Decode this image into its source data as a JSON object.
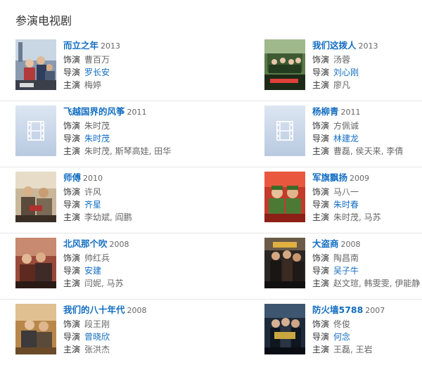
{
  "section_title": "参演电视剧",
  "labels": {
    "role": "饰演",
    "director": "导演",
    "cast": "主演"
  },
  "items": [
    {
      "title": "而立之年",
      "year": "2013",
      "role": "曹百万",
      "director": "罗长安",
      "cast": "梅婷",
      "poster": "photo"
    },
    {
      "title": "我们这拨人",
      "year": "2013",
      "role": "汤蓉",
      "director": "刘心刚",
      "cast": "廖凡",
      "poster": "photo"
    },
    {
      "title": "飞越国界的风筝",
      "year": "2011",
      "role": "朱时茂",
      "director": "朱时茂",
      "cast": "朱时茂, 斯琴高娃, 田华",
      "poster": "placeholder"
    },
    {
      "title": "杨柳青",
      "year": "2011",
      "role": "方佩诚",
      "director": "林建龙",
      "cast": "曹磊, 侯天来, 李倩",
      "poster": "placeholder"
    },
    {
      "title": "师傅",
      "year": "2010",
      "role": "许风",
      "director": "齐星",
      "cast": "李幼斌, 阎鹏",
      "poster": "photo"
    },
    {
      "title": "军旗飘扬",
      "year": "2009",
      "role": "马八一",
      "director": "朱时春",
      "cast": "朱时茂, 马苏",
      "poster": "photo"
    },
    {
      "title": "北风那个吹",
      "year": "2008",
      "role": "帅红兵",
      "director": "安建",
      "cast": "闫妮, 马苏",
      "poster": "photo"
    },
    {
      "title": "大盗商",
      "year": "2008",
      "role": "陶昌南",
      "director": "吴子牛",
      "cast": "赵文瑄, 韩雯雯, 伊能静",
      "poster": "photo"
    },
    {
      "title": "我们的八十年代",
      "year": "2008",
      "role": "段王刚",
      "director": "曾晓欣",
      "cast": "张洪杰",
      "poster": "photo"
    },
    {
      "title": "防火墙5788",
      "year": "2007",
      "role": "佟俊",
      "director": "何念",
      "cast": "王磊, 王岩",
      "poster": "photo"
    }
  ]
}
